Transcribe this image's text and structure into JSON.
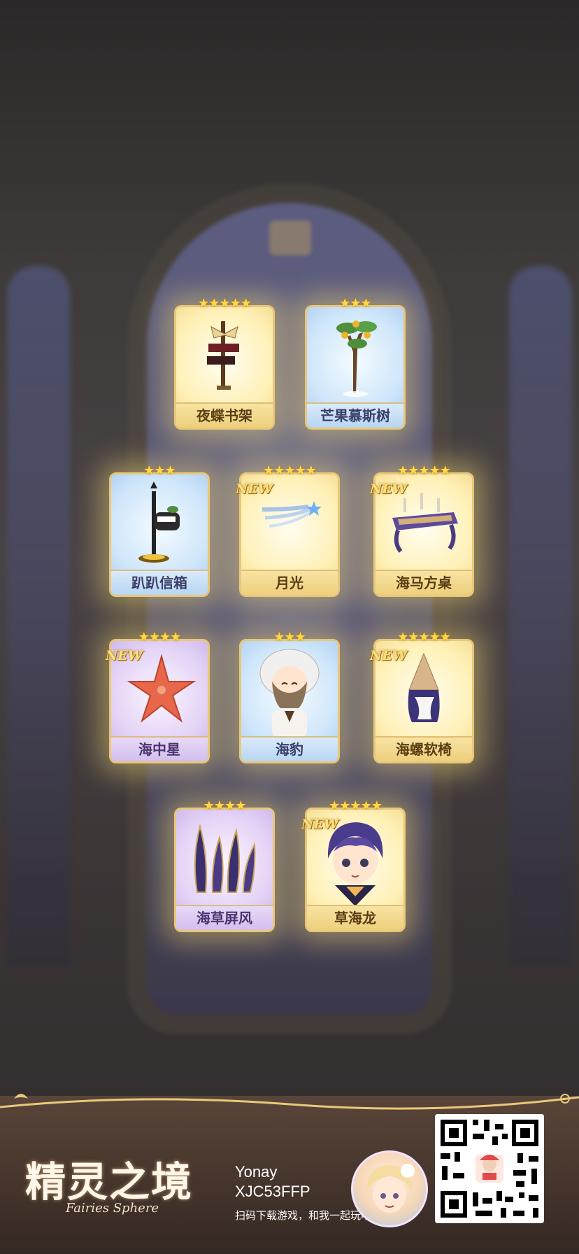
{
  "rewards": [
    {
      "name": "夜蝶书架",
      "stars": "★★★★★",
      "is_new": false,
      "new_label": "",
      "rarity": "gold",
      "icon": "bookshelf-icon"
    },
    {
      "name": "芒果慕斯树",
      "stars": "★★★",
      "is_new": false,
      "new_label": "",
      "rarity": "blue",
      "icon": "mango-tree-icon"
    },
    {
      "name": "趴趴信箱",
      "stars": "★★★",
      "is_new": false,
      "new_label": "",
      "rarity": "blue",
      "icon": "mailbox-icon"
    },
    {
      "name": "月光",
      "stars": "★★★★★",
      "is_new": true,
      "new_label": "NEW",
      "rarity": "gold",
      "icon": "moonlight-effect-icon"
    },
    {
      "name": "海马方桌",
      "stars": "★★★★★",
      "is_new": true,
      "new_label": "NEW",
      "rarity": "gold",
      "icon": "table-icon"
    },
    {
      "name": "海中星",
      "stars": "★★★★",
      "is_new": true,
      "new_label": "NEW",
      "rarity": "purple",
      "icon": "starfish-icon"
    },
    {
      "name": "海豹",
      "stars": "★★★",
      "is_new": false,
      "new_label": "",
      "rarity": "blue",
      "icon": "seal-outfit-icon"
    },
    {
      "name": "海螺软椅",
      "stars": "★★★★★",
      "is_new": true,
      "new_label": "NEW",
      "rarity": "gold",
      "icon": "conch-chair-icon"
    },
    {
      "name": "海草屏风",
      "stars": "★★★★",
      "is_new": false,
      "new_label": "",
      "rarity": "purple",
      "icon": "seaweed-screen-icon"
    },
    {
      "name": "草海龙",
      "stars": "★★★★★",
      "is_new": true,
      "new_label": "NEW",
      "rarity": "gold",
      "icon": "character-portrait-icon"
    }
  ],
  "footer": {
    "logo_cn": "精灵之境",
    "logo_en": "Fairies Sphere",
    "user_name": "Yonay",
    "user_code": "XJC53FFP",
    "invite_text": "扫码下载游戏，和我一起玩吧！",
    "avatar_icon": "player-avatar-icon",
    "qr_icon": "qr-code-icon"
  },
  "colors": {
    "gold_card": "#fff1b8",
    "blue_card": "#cfe6fb",
    "purple_card": "#e3d2f6",
    "star": "#ffd84a",
    "card_border": "#e8c77a"
  }
}
